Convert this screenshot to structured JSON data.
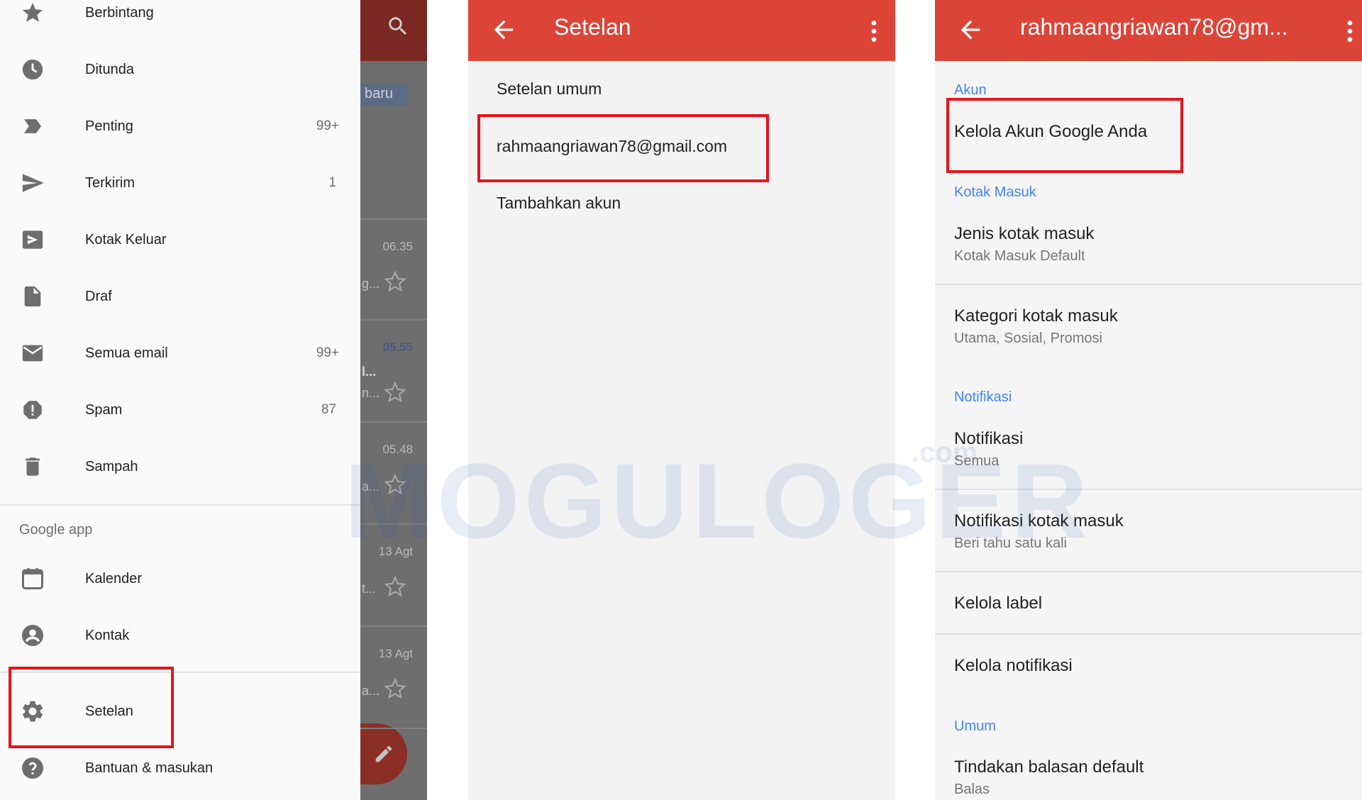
{
  "drawer": {
    "items": [
      {
        "label": "Berbintang",
        "count": "",
        "icon": "star-icon"
      },
      {
        "label": "Ditunda",
        "count": "",
        "icon": "clock-icon"
      },
      {
        "label": "Penting",
        "count": "99+",
        "icon": "label-important-icon"
      },
      {
        "label": "Terkirim",
        "count": "1",
        "icon": "send-icon"
      },
      {
        "label": "Kotak Keluar",
        "count": "",
        "icon": "outbox-icon"
      },
      {
        "label": "Draf",
        "count": "",
        "icon": "draft-icon"
      },
      {
        "label": "Semua email",
        "count": "99+",
        "icon": "all-mail-icon"
      },
      {
        "label": "Spam",
        "count": "87",
        "icon": "spam-icon"
      },
      {
        "label": "Sampah",
        "count": "",
        "icon": "trash-icon"
      }
    ],
    "section_label": "Google app",
    "apps": [
      {
        "label": "Kalender",
        "icon": "calendar-icon"
      },
      {
        "label": "Kontak",
        "icon": "contact-icon"
      }
    ],
    "settings_label": "Setelan",
    "help_label": "Bantuan & masukan"
  },
  "background_inbox": {
    "new_badge": "baru",
    "rows": [
      {
        "time": "06.35",
        "snippet": "g...",
        "bold": false
      },
      {
        "time": "05.55",
        "snippet": "n...",
        "bold": true
      },
      {
        "time": "05.48",
        "snippet": "a...",
        "bold": false
      },
      {
        "time": "13 Agt",
        "snippet": "t...",
        "bold": false
      },
      {
        "time": "13 Agt",
        "snippet": "a...",
        "bold": false
      }
    ]
  },
  "setelan_screen": {
    "title": "Setelan",
    "items": [
      "Setelan umum",
      "rahmaangriawan78@gmail.com",
      "Tambahkan akun"
    ]
  },
  "account_screen": {
    "title": "rahmaangriawan78@gm...",
    "sections": {
      "akun": "Akun",
      "kotak_masuk": "Kotak Masuk",
      "notifikasi": "Notifikasi",
      "umum": "Umum"
    },
    "manage_account": "Kelola Akun Google Anda",
    "inbox_type": {
      "title": "Jenis kotak masuk",
      "sub": "Kotak Masuk Default"
    },
    "inbox_categories": {
      "title": "Kategori kotak masuk",
      "sub": "Utama, Sosial, Promosi"
    },
    "notifications": {
      "title": "Notifikasi",
      "sub": "Semua"
    },
    "inbox_notifications": {
      "title": "Notifikasi kotak masuk",
      "sub": "Beri tahu satu kali"
    },
    "manage_labels": "Kelola label",
    "manage_notifications": "Kelola notifikasi",
    "default_reply": {
      "title": "Tindakan balasan default",
      "sub": "Balas"
    }
  },
  "watermark": {
    "text": "MOGULOGER",
    "suffix": ".com"
  },
  "colors": {
    "appbar": "#db4437",
    "highlight": "#e5141b",
    "section_header": "#4285f4",
    "drawer_icon": "#6e6e6e"
  }
}
